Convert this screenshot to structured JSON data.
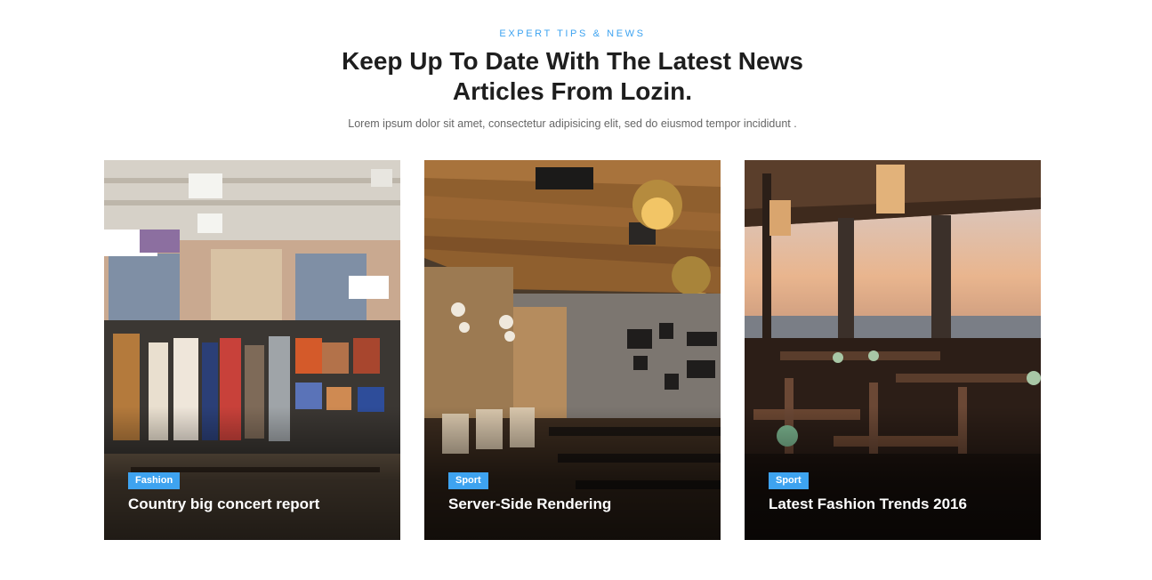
{
  "header": {
    "eyebrow": "EXPERT TIPS & NEWS",
    "title_line1": "Keep Up To Date With The Latest News",
    "title_line2": "Articles From Lozin.",
    "subtitle": "Lorem ipsum dolor sit amet, consectetur adipisicing elit, sed do eiusmod tempor incididunt ."
  },
  "cards": [
    {
      "category": "Fashion",
      "title": "Country big concert report",
      "image": "clothing-store-photo"
    },
    {
      "category": "Sport",
      "title": "Server-Side Rendering",
      "image": "restaurant-interior-photo"
    },
    {
      "category": "Sport",
      "title": "Latest Fashion Trends 2016",
      "image": "seaside-restaurant-photo"
    }
  ],
  "colors": {
    "accent": "#3ea3f0",
    "heading": "#1e1e1e",
    "body_text": "#666666"
  }
}
